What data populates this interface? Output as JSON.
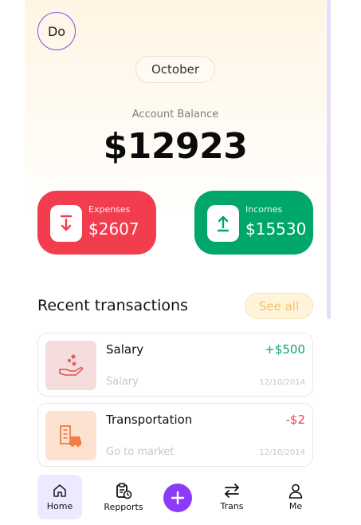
{
  "header": {
    "avatar_initials": "Do",
    "month": "October"
  },
  "balance": {
    "label": "Account Balance",
    "value": "$12923"
  },
  "summary": {
    "expenses": {
      "label": "Expenses",
      "value": "$2607",
      "color": "#f23d4e",
      "icon": "arrow-down-icon"
    },
    "incomes": {
      "label": "Incomes",
      "value": "$15530",
      "color": "#00a66a",
      "icon": "arrow-up-icon"
    }
  },
  "recent": {
    "title": "Recent transactions",
    "see_all": "See all",
    "items": [
      {
        "title": "Salary",
        "subtitle": "Salary",
        "amount": "+$500",
        "date": "12/10/2014",
        "icon": "hand-coins-icon",
        "type": "income"
      },
      {
        "title": "Transportation",
        "subtitle": "Go to market",
        "amount": "-$2",
        "date": "12/10/2014",
        "icon": "car-building-icon",
        "type": "expense"
      }
    ]
  },
  "tabs": [
    {
      "label": "Home",
      "icon": "home-icon",
      "active": true
    },
    {
      "label": "Repports",
      "icon": "clipboard-clock-icon",
      "active": false
    },
    {
      "label": "",
      "icon": "plus-icon",
      "active": false
    },
    {
      "label": "Trans",
      "icon": "swap-arrows-icon",
      "active": false
    },
    {
      "label": "Me",
      "icon": "user-icon",
      "active": false
    }
  ],
  "colors": {
    "accent": "#8b3cf7",
    "expense": "#f23d4e",
    "income": "#00a66a",
    "see_all": "#f0c469"
  }
}
